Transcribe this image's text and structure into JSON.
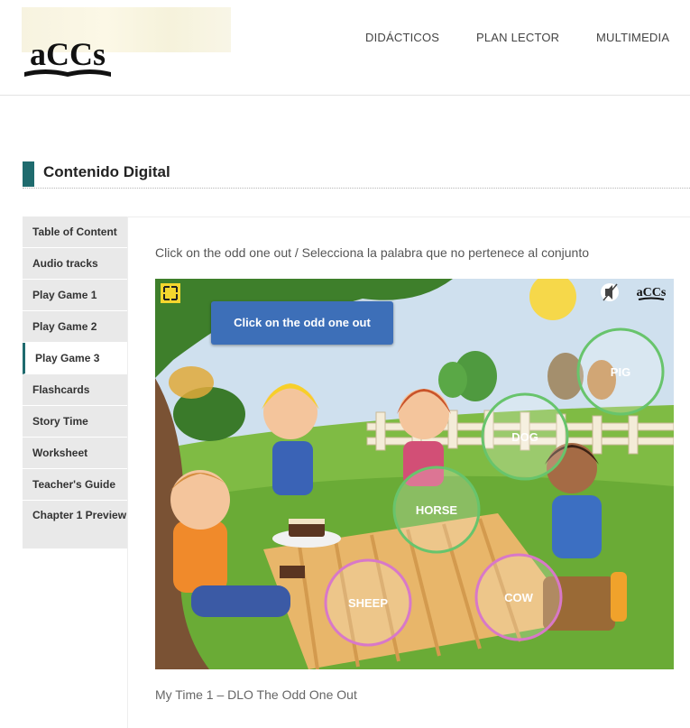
{
  "header": {
    "logo_text": "aCCs",
    "nav": [
      "DIDÁCTICOS",
      "PLAN LECTOR",
      "MULTIMEDIA"
    ]
  },
  "section": {
    "title": "Contenido Digital"
  },
  "sidebar": {
    "items": [
      {
        "label": "Table of Content"
      },
      {
        "label": "Audio tracks"
      },
      {
        "label": "Play Game 1"
      },
      {
        "label": "Play Game 2"
      },
      {
        "label": "Play Game 3"
      },
      {
        "label": "Flashcards"
      },
      {
        "label": "Story Time"
      },
      {
        "label": "Worksheet"
      },
      {
        "label": "Teacher's Guide"
      },
      {
        "label": "Chapter 1 Preview"
      }
    ],
    "active_index": 4
  },
  "main": {
    "instruction": "Click on the odd one out / Selecciona la palabra que no pertenece al conjunto",
    "caption": "My Time 1 – DLO The Odd One Out"
  },
  "game": {
    "banner": "Click on the odd one out",
    "logo_text": "aCCs",
    "bubbles": [
      "PIG",
      "DOG",
      "HORSE",
      "SHEEP",
      "COW"
    ]
  },
  "colors": {
    "accent": "#1f6b6e",
    "banner": "#3d6fb8",
    "sky": "#c9dcec",
    "grass": "#6db33f"
  }
}
